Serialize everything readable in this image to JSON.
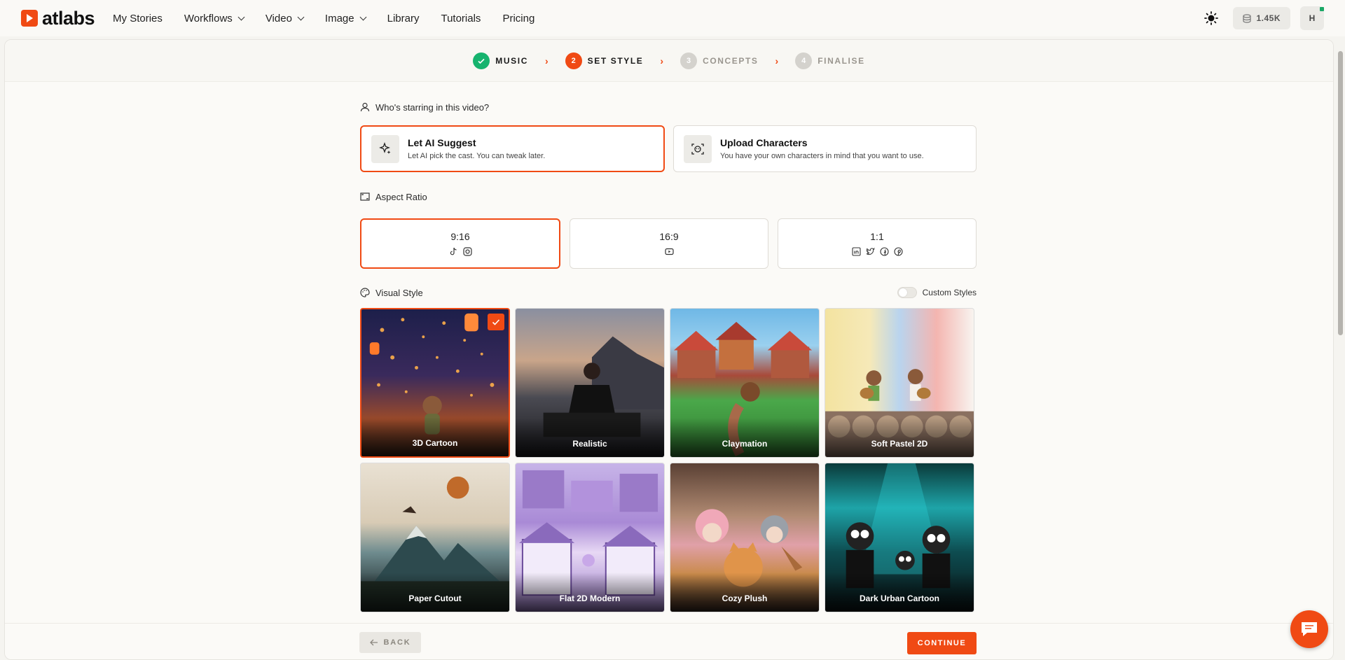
{
  "brand": {
    "name": "atlabs",
    "accent": "#f04a14"
  },
  "nav": {
    "items": [
      {
        "label": "My Stories",
        "dropdown": false
      },
      {
        "label": "Workflows",
        "dropdown": true
      },
      {
        "label": "Video",
        "dropdown": true
      },
      {
        "label": "Image",
        "dropdown": true
      },
      {
        "label": "Library",
        "dropdown": false
      },
      {
        "label": "Tutorials",
        "dropdown": false
      },
      {
        "label": "Pricing",
        "dropdown": false
      }
    ],
    "credits": "1.45K",
    "avatar_initial": "H",
    "theme_icon": "sun-icon"
  },
  "stepper": {
    "steps": [
      {
        "num": "",
        "label": "MUSIC",
        "state": "done"
      },
      {
        "num": "2",
        "label": "SET STYLE",
        "state": "active"
      },
      {
        "num": "3",
        "label": "CONCEPTS",
        "state": "todo"
      },
      {
        "num": "4",
        "label": "FINALISE",
        "state": "todo"
      }
    ],
    "separator": "›"
  },
  "cast": {
    "question": "Who's starring in this video?",
    "options": [
      {
        "title": "Let AI Suggest",
        "subtitle": "Let AI pick the cast. You can tweak later.",
        "icon": "sparkle-icon",
        "selected": true
      },
      {
        "title": "Upload Characters",
        "subtitle": "You have your own characters in mind that you want to use.",
        "icon": "face-scan-icon",
        "selected": false
      }
    ]
  },
  "aspect": {
    "label": "Aspect Ratio",
    "options": [
      {
        "ratio": "9:16",
        "icons": [
          "tiktok-icon",
          "instagram-icon"
        ],
        "selected": true
      },
      {
        "ratio": "16:9",
        "icons": [
          "youtube-icon"
        ],
        "selected": false
      },
      {
        "ratio": "1:1",
        "icons": [
          "linkedin-icon",
          "twitter-icon",
          "facebook-icon",
          "pinterest-icon"
        ],
        "selected": false
      }
    ]
  },
  "visual_style": {
    "label": "Visual Style",
    "custom_styles_label": "Custom Styles",
    "custom_styles_on": false,
    "styles": [
      {
        "name": "3D Cartoon",
        "selected": true,
        "bg": "linear-gradient(180deg,#1d1f4a 0%,#3a2a5c 45%,#9a4a2a 75%,#3a2418 100%)"
      },
      {
        "name": "Realistic",
        "selected": false,
        "bg": "linear-gradient(180deg,#8a8fa0 0%,#c9a58a 35%,#4a4a52 60%,#1a1a1e 100%)"
      },
      {
        "name": "Claymation",
        "selected": false,
        "bg": "linear-gradient(180deg,#6fb8e6 0%,#9ad0ef 25%,#a84a3a 45%,#4aa84a 62%,#2f7a2f 100%)"
      },
      {
        "name": "Soft Pastel 2D",
        "selected": false,
        "bg": "linear-gradient(90deg,#f3e3a0 0%,#f6e9b8 30%,#b9d4ee 50%,#f4b5b0 75%,#f8f4f0 100%)"
      },
      {
        "name": "Paper Cutout",
        "selected": false,
        "bg": "linear-gradient(180deg,#e9e1d3 0%,#d8cbb5 40%,#6f8c8f 60%,#2c3c3e 85%,#1c2626 100%)"
      },
      {
        "name": "Flat 2D Modern",
        "selected": false,
        "bg": "linear-gradient(180deg,#c7b4e8 0%,#a98ad6 40%,#e7d8f4 60%,#9c7ec9 100%)"
      },
      {
        "name": "Cozy Plush",
        "selected": false,
        "bg": "linear-gradient(180deg,#5a4034 0%,#b08a72 35%,#e0a0a8 55%,#c98a4a 75%,#3a2a22 100%)"
      },
      {
        "name": "Dark Urban Cartoon",
        "selected": false,
        "bg": "linear-gradient(180deg,#0a3a3a 0%,#1ea4a8 30%,#0d4c50 60%,#0a1416 100%)"
      }
    ]
  },
  "footer": {
    "back_label": "BACK",
    "continue_label": "CONTINUE"
  }
}
